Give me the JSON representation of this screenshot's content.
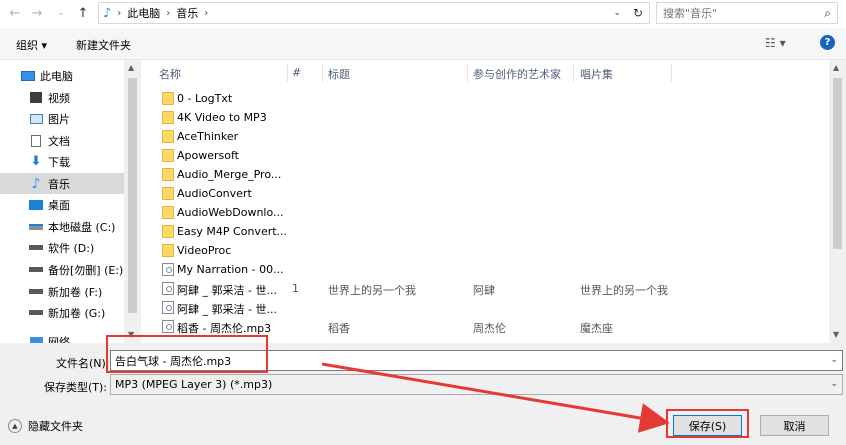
{
  "address_bar": {
    "crumbs": [
      "此电脑",
      "音乐"
    ],
    "search_placeholder": "搜索\"音乐\""
  },
  "toolbar": {
    "organize_label": "组织 ▾",
    "new_folder_label": "新建文件夹",
    "help_label": "?"
  },
  "nav": {
    "items": [
      {
        "label": "此电脑",
        "icon": "computer-icon"
      },
      {
        "label": "视频",
        "icon": "video-icon"
      },
      {
        "label": "图片",
        "icon": "pictures-icon"
      },
      {
        "label": "文档",
        "icon": "documents-icon"
      },
      {
        "label": "下载",
        "icon": "download-icon"
      },
      {
        "label": "音乐",
        "icon": "music-icon"
      },
      {
        "label": "桌面",
        "icon": "desktop-icon"
      },
      {
        "label": "本地磁盘 (C:)",
        "icon": "drive-icon"
      },
      {
        "label": "软件 (D:)",
        "icon": "drive-icon"
      },
      {
        "label": "备份[勿删] (E:)",
        "icon": "drive-icon"
      },
      {
        "label": "新加卷 (F:)",
        "icon": "drive-icon"
      },
      {
        "label": "新加卷 (G:)",
        "icon": "drive-icon"
      },
      {
        "label": "网络",
        "icon": "network-icon"
      }
    ],
    "selected_index": 5
  },
  "columns": {
    "name": "名称",
    "num": "#",
    "title": "标题",
    "artists": "参与创作的艺术家",
    "album": "唱片集"
  },
  "files": [
    {
      "name": "0 - LogTxt",
      "type": "folder",
      "num": "",
      "title": "",
      "artist": "",
      "album": ""
    },
    {
      "name": "4K Video to MP3",
      "type": "folder",
      "num": "",
      "title": "",
      "artist": "",
      "album": ""
    },
    {
      "name": "AceThinker",
      "type": "folder",
      "num": "",
      "title": "",
      "artist": "",
      "album": ""
    },
    {
      "name": "Apowersoft",
      "type": "folder",
      "num": "",
      "title": "",
      "artist": "",
      "album": ""
    },
    {
      "name": "Audio_Merge_Pro...",
      "type": "folder",
      "num": "",
      "title": "",
      "artist": "",
      "album": ""
    },
    {
      "name": "AudioConvert",
      "type": "folder",
      "num": "",
      "title": "",
      "artist": "",
      "album": ""
    },
    {
      "name": "AudioWebDownlo...",
      "type": "folder",
      "num": "",
      "title": "",
      "artist": "",
      "album": ""
    },
    {
      "name": "Easy M4P Convert...",
      "type": "folder",
      "num": "",
      "title": "",
      "artist": "",
      "album": ""
    },
    {
      "name": "VideoProc",
      "type": "folder",
      "num": "",
      "title": "",
      "artist": "",
      "album": ""
    },
    {
      "name": "My Narration - 00...",
      "type": "audio",
      "num": "",
      "title": "",
      "artist": "",
      "album": ""
    },
    {
      "name": "阿肆 _ 郭采洁 - 世...",
      "type": "audio",
      "num": "1",
      "title": "世界上的另一个我",
      "artist": "阿肆",
      "album": "世界上的另一个我"
    },
    {
      "name": "阿肆 _ 郭采洁 - 世...",
      "type": "audio",
      "num": "",
      "title": "",
      "artist": "",
      "album": ""
    },
    {
      "name": "稻香 - 周杰伦.mp3",
      "type": "audio",
      "num": "",
      "title": "稻香",
      "artist": "周杰伦",
      "album": "魔杰座"
    }
  ],
  "bottom": {
    "filename_label": "文件名(N):",
    "filename_value": "告白气球 - 周杰伦.mp3",
    "filetype_label": "保存类型(T):",
    "filetype_value": "MP3 (MPEG Layer 3) (*.mp3)",
    "hide_folders_label": "隐藏文件夹",
    "save_label": "保存(S)",
    "cancel_label": "取消"
  },
  "annotation_color": "#e53935"
}
